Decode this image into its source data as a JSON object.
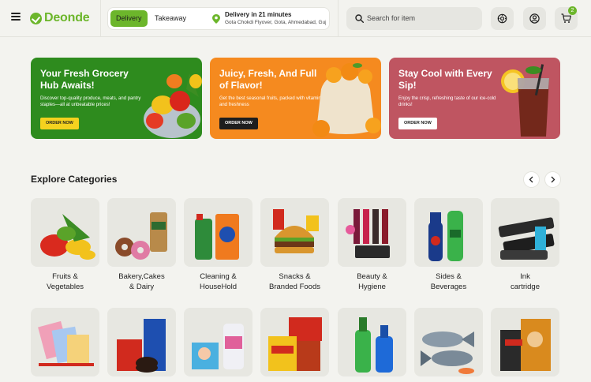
{
  "brand": {
    "name": "Deonde",
    "color": "#6cb62b"
  },
  "header": {
    "modes": [
      "Delivery",
      "Takeaway"
    ],
    "active_mode": "Delivery",
    "delivery_title": "Delivery in 21 minutes",
    "delivery_address": "Gota Chokdi Flyover, Gota, Ahmedabad, Guj...",
    "search_placeholder": "Search for item",
    "cart_count": "2",
    "icons": [
      "menu-icon",
      "location-pin-icon",
      "search-icon",
      "settings-icon",
      "user-icon",
      "cart-icon"
    ]
  },
  "banners": [
    {
      "title": "Your Fresh Grocery Hub Awaits!",
      "subtitle": "Discover top-quality produce, meats, and pantry staples—all at unbeatable prices!",
      "button": "ORDER NOW",
      "bg": "#2e8b1e",
      "button_bg": "#f4d21f",
      "button_color": "#1e1e1e"
    },
    {
      "title": "Juicy, Fresh, And Full of Flavor!",
      "subtitle": "Get the best seasonal fruits, packed with vitamins and freshness",
      "button": "ORDER NOW",
      "bg": "#f58a1f",
      "button_bg": "#1e1e1e",
      "button_color": "#ffffff"
    },
    {
      "title": "Stay Cool with Every Sip!",
      "subtitle": "Enjoy the crisp, refreshing taste of our ice-cold drinks!",
      "button": "ORDER NOW",
      "bg": "#bf5561",
      "button_bg": "#ffffff",
      "button_color": "#1e1e1e"
    }
  ],
  "categories_section": {
    "title": "Explore Categories",
    "row1": [
      {
        "label": "Fruits &\nVegetables",
        "icon": "vegetables-icon"
      },
      {
        "label": "Bakery,Cakes\n& Dairy",
        "icon": "bakery-icon"
      },
      {
        "label": "Cleaning &\nHouseHold",
        "icon": "detergent-icon"
      },
      {
        "label": "Snacks &\nBranded Foods",
        "icon": "burger-icon"
      },
      {
        "label": "Beauty &\nHygiene",
        "icon": "cosmetics-icon"
      },
      {
        "label": "Sides &\nBeverages",
        "icon": "soda-bottles-icon"
      },
      {
        "label": "Ink\ncartridge",
        "icon": "ink-cartridge-icon"
      }
    ],
    "row2": [
      {
        "icon": "stationery-icon"
      },
      {
        "icon": "biscuits-icon"
      },
      {
        "icon": "baby-care-icon"
      },
      {
        "icon": "spices-icon"
      },
      {
        "icon": "hair-oil-icon"
      },
      {
        "icon": "fish-icon"
      },
      {
        "icon": "pet-food-icon"
      }
    ]
  }
}
